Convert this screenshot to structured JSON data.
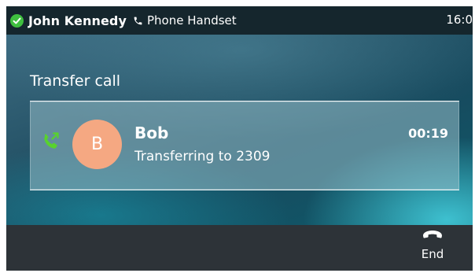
{
  "status_bar": {
    "user_name": "John Kennedy",
    "audio_device": "Phone Handset",
    "time": "16:0"
  },
  "main": {
    "title": "Transfer call",
    "call": {
      "avatar_initial": "B",
      "contact_name": "Bob",
      "status_text": "Transferring to 2309",
      "duration": "00:19"
    }
  },
  "softkeys": {
    "end_label": "End"
  },
  "icons": {
    "presence": "check-circle-icon",
    "audio_device": "phone-handset-icon",
    "call_state": "call-transfer-icon",
    "end": "hang-up-icon"
  },
  "colors": {
    "presence_online": "#3fbf3f",
    "transfer_icon": "#58d22e",
    "avatar": "#f5a882",
    "end_icon": "#ffffff"
  }
}
